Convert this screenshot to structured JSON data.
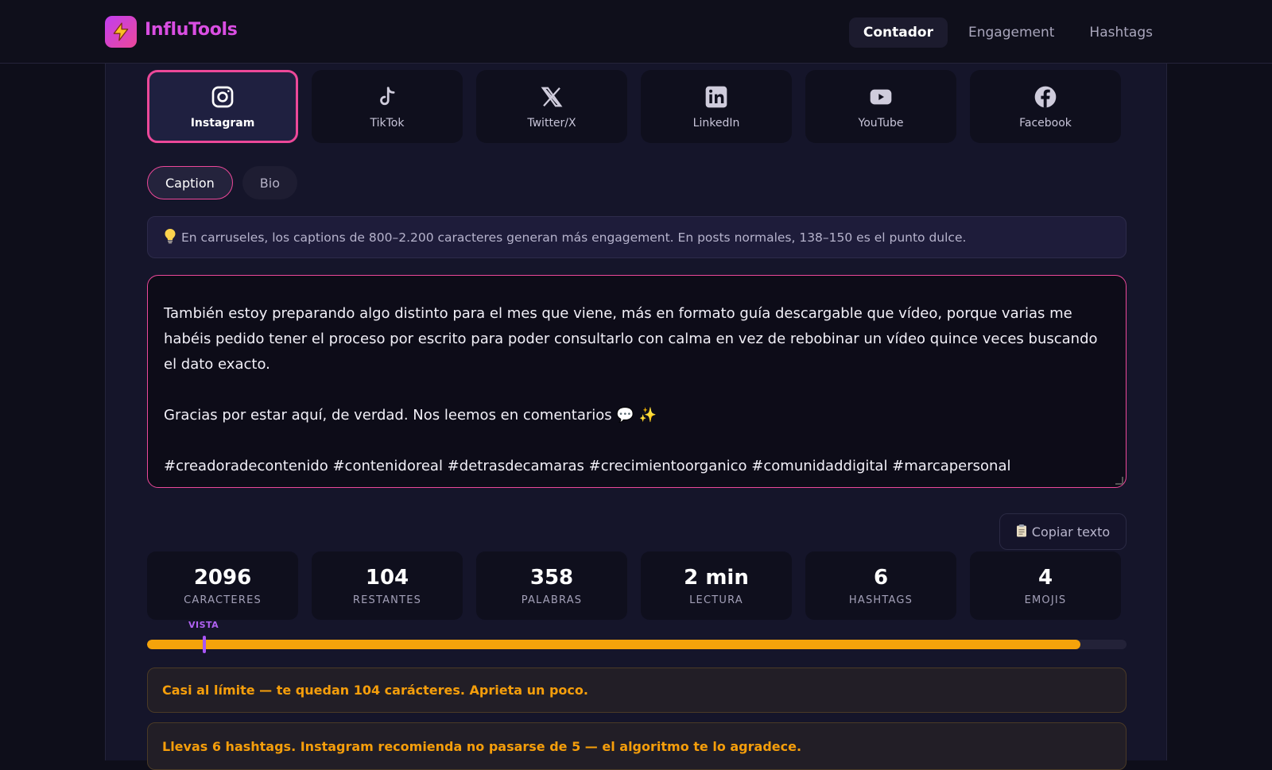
{
  "app": {
    "name": "InfluTools"
  },
  "nav": [
    {
      "label": "Contador",
      "active": true
    },
    {
      "label": "Engagement",
      "active": false
    },
    {
      "label": "Hashtags",
      "active": false
    }
  ],
  "platforms": [
    {
      "label": "Instagram",
      "icon": "instagram-icon",
      "active": true
    },
    {
      "label": "TikTok",
      "icon": "tiktok-icon",
      "active": false
    },
    {
      "label": "Twitter/X",
      "icon": "x-icon",
      "active": false
    },
    {
      "label": "LinkedIn",
      "icon": "linkedin-icon",
      "active": false
    },
    {
      "label": "YouTube",
      "icon": "youtube-icon",
      "active": false
    },
    {
      "label": "Facebook",
      "icon": "facebook-icon",
      "active": false
    }
  ],
  "modes": [
    {
      "label": "Caption",
      "active": true
    },
    {
      "label": "Bio",
      "active": false
    }
  ],
  "tip": {
    "icon": "lightbulb-icon",
    "text": "En carruseles, los captions de 800–2.200 caracteres generan más engagement. En posts normales, 138–150 es el punto dulce."
  },
  "editor": {
    "visible_text": "doy prioridad esta misma semana antes de pasar a la siguiente idea que tengo en la lista.\n\nTambién estoy preparando algo distinto para el mes que viene, más en formato guía descargable que vídeo, porque varias me habéis pedido tener el proceso por escrito para poder consultarlo con calma en vez de rebobinar un vídeo quince veces buscando el dato exacto.\n\nGracias por estar aquí, de verdad. Nos leemos en comentarios 💬 ✨\n\n#creadoradecontenido #contenidoreal #detrasdecamaras #crecimientoorganico #comunidaddigital #marcapersonal"
  },
  "copy_button": {
    "label": "Copiar texto",
    "icon": "clipboard-icon"
  },
  "stats": [
    {
      "value": "2096",
      "label": "CARACTERES"
    },
    {
      "value": "104",
      "label": "RESTANTES"
    },
    {
      "value": "358",
      "label": "PALABRAS"
    },
    {
      "value": "2 min",
      "label": "LECTURA"
    },
    {
      "value": "6",
      "label": "HASHTAGS"
    },
    {
      "value": "4",
      "label": "EMOJIS"
    }
  ],
  "progress": {
    "vista_label": "VISTA",
    "fill_percent": 95.3
  },
  "alerts": [
    "Casi al límite — te quedan 104 carácteres. Aprieta un poco.",
    "Llevas 6 hashtags. Instagram recomienda no pasarse de 5 — el algoritmo te lo agradece."
  ],
  "colors": {
    "accent": "#ec4899",
    "warning": "#f59e0b",
    "vista": "#a855f7",
    "brand": "#d94ee2"
  }
}
